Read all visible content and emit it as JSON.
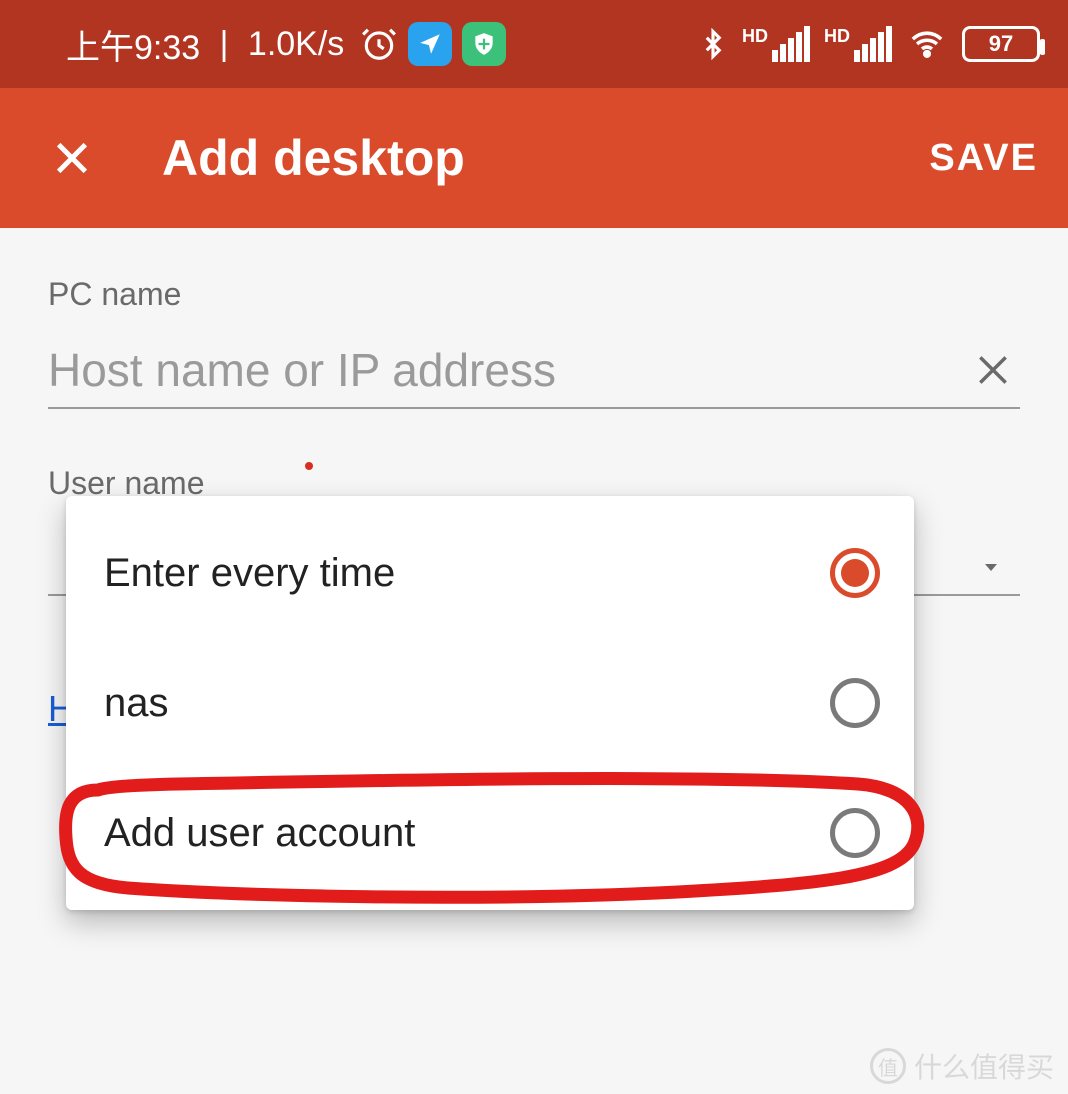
{
  "statusBar": {
    "time": "上午9:33",
    "netSpeed": "1.0K/s",
    "hdLabel": "HD",
    "battery": "97"
  },
  "appBar": {
    "title": "Add desktop",
    "saveLabel": "SAVE"
  },
  "form": {
    "pcNameLabel": "PC name",
    "pcNamePlaceholder": "Host name or IP address",
    "pcNameValue": "",
    "userNameLabel": "User name",
    "hiddenLinkChar": "H"
  },
  "userOptions": [
    {
      "label": "Enter every time",
      "selected": true
    },
    {
      "label": "nas",
      "selected": false
    },
    {
      "label": "Add user account",
      "selected": false
    }
  ],
  "watermark": {
    "text": "什么值得买",
    "iconText": "值"
  }
}
